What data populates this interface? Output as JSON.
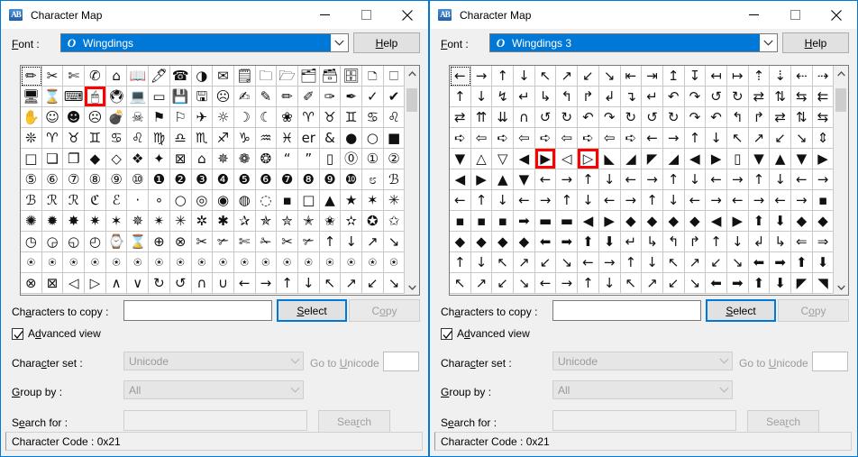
{
  "windows": [
    {
      "title": "Character Map",
      "app_icon": "character-map-icon",
      "controls": {
        "minimize": "Minimize",
        "maximize": "Maximize",
        "close": "Close"
      },
      "font": {
        "label": "Font :",
        "label_prefix": "F",
        "label_rest": "ont :",
        "value": "Wingdings",
        "tt_icon": "truetype-icon",
        "dropdown_icon": "chevron-down-icon"
      },
      "help_label": "Help",
      "grid": {
        "columns": 18,
        "rows": 11,
        "selected_index": 0,
        "highlight_indices": [
          21
        ],
        "scrollbar": {
          "up_icon": "chevron-up-icon",
          "down_icon": "chevron-down-icon",
          "thumb_position": "top"
        },
        "chars": [
          "✏",
          "✂",
          "✄",
          "✆",
          "⌂",
          "📖",
          "🖊",
          "☎",
          "◑",
          "✉",
          "🗒",
          "🗀",
          "🗁",
          "🗂",
          "🗃",
          "🗄",
          "🗅",
          "🗆",
          "🖥",
          "⌛",
          "⌨",
          "🖱",
          "🖲",
          "💻",
          "▭",
          "💾",
          "🖫",
          "☹",
          "✍",
          "✎",
          "✏",
          "✐",
          "✑",
          "✒",
          "✓",
          "✔",
          "✋",
          "☺",
          "☻",
          "☹",
          "💣",
          "☠",
          "⚑",
          "⚐",
          "✈",
          "☼",
          "☽",
          "☾",
          "❀",
          "♈",
          "♉",
          "♊",
          "♋",
          "♌",
          "❊",
          "♈",
          "♉",
          "♊",
          "♋",
          "♌",
          "♍",
          "♎",
          "♏",
          "♐",
          "♑",
          "♒",
          "♓",
          "er",
          "&",
          "●",
          "○",
          "■",
          "□",
          "❏",
          "❐",
          "◆",
          "◇",
          "❖",
          "✦",
          "⊠",
          "⌂",
          "✵",
          "❁",
          "❂",
          "“",
          "”",
          "▯",
          "⓪",
          "①",
          "②",
          "⑤",
          "⑥",
          "⑦",
          "⑧",
          "⑨",
          "⑩",
          "❶",
          "❷",
          "❸",
          "❹",
          "❺",
          "❻",
          "❼",
          "❽",
          "❾",
          "❿",
          "೮",
          "ℬ",
          "ℬ",
          "ℛ",
          "ℛ",
          "ℭ",
          "ℰ",
          "·",
          "∘",
          "○",
          "◎",
          "◉",
          "◍",
          "◌",
          "▪",
          "□",
          "▲",
          "★",
          "✶",
          "✳",
          "✺",
          "✹",
          "✸",
          "✷",
          "✶",
          "✵",
          "✴",
          "✳",
          "✲",
          "✱",
          "✰",
          "✯",
          "✮",
          "✭",
          "✬",
          "✫",
          "✪",
          "✩",
          "◷",
          "◶",
          "◵",
          "◴",
          "⌚",
          "⌛",
          "⊕",
          "⊗",
          "✂",
          "✃",
          "✄",
          "✁",
          "✂",
          "✃",
          "↑",
          "↓",
          "↗",
          "↘",
          "⍟",
          "⍟",
          "⍟",
          "⍟",
          "⍟",
          "⍟",
          "⍟",
          "⍟",
          "⍟",
          "⍟",
          "⍟",
          "⍟",
          "⍟",
          "⍟",
          "⍟",
          "⍟",
          "⍟",
          "⍟",
          "⊗",
          "⊠",
          "◁",
          "▷",
          "∧",
          "∨",
          "↻",
          "↺",
          "∩",
          "∪",
          "←",
          "→",
          "↑",
          "↓",
          "↖",
          "↗",
          "↙",
          "↘"
        ]
      },
      "form": {
        "characters_to_copy_label": "Characters to copy :",
        "characters_to_copy_value": "",
        "select_label": "Select",
        "copy_label": "Copy",
        "advanced_view_label": "Advanced view",
        "advanced_view_checked": true,
        "character_set_label": "Character set :",
        "character_set_value": "Unicode",
        "go_to_unicode_label": "Go to Unicode :",
        "go_to_unicode_value": "",
        "group_by_label": "Group by :",
        "group_by_value": "All",
        "search_for_label": "Search for :",
        "search_for_value": "",
        "search_label": "Search"
      },
      "status": "Character Code : 0x21"
    },
    {
      "title": "Character Map",
      "app_icon": "character-map-icon",
      "controls": {
        "minimize": "Minimize",
        "maximize": "Maximize",
        "close": "Close"
      },
      "font": {
        "label": "Font :",
        "label_prefix": "F",
        "label_rest": "ont :",
        "value": "Wingdings 3",
        "tt_icon": "truetype-icon",
        "dropdown_icon": "chevron-down-icon"
      },
      "help_label": "Help",
      "grid": {
        "columns": 18,
        "rows": 11,
        "selected_index": 0,
        "highlight_indices": [
          76,
          78
        ],
        "scrollbar": {
          "up_icon": "chevron-up-icon",
          "down_icon": "chevron-down-icon",
          "thumb_position": "top"
        },
        "chars": [
          "←",
          "→",
          "↑",
          "↓",
          "↖",
          "↗",
          "↙",
          "↘",
          "⇤",
          "⇥",
          "↥",
          "↧",
          "↤",
          "↦",
          "⇡",
          "⇣",
          "⇠",
          "⇢",
          "↑",
          "↓",
          "↯",
          "↵",
          "↳",
          "↰",
          "↱",
          "↲",
          "↴",
          "↵",
          "↶",
          "↷",
          "↺",
          "↻",
          "⇄",
          "⇅",
          "⇆",
          "⇇",
          "⇄",
          "⇈",
          "⇊",
          "∩",
          "↺",
          "↻",
          "↶",
          "↷",
          "↻",
          "↺",
          "↻",
          "↷",
          "↶",
          "↰",
          "↱",
          "⇄",
          "⇅",
          "⇆",
          "➪",
          "⇦",
          "➪",
          "⇦",
          "➪",
          "⇦",
          "➪",
          "⇦",
          "➪",
          "←",
          "→",
          "↑",
          "↓",
          "↖",
          "↗",
          "↙",
          "↘",
          "⇕",
          "▼",
          "△",
          "▽",
          "◀",
          "▶",
          "◁",
          "▷",
          "◣",
          "◢",
          "◤",
          "◢",
          "◀",
          "▶",
          "▯",
          "▼",
          "▲",
          "▼",
          "▶",
          "◀",
          "▶",
          "▲",
          "▼",
          "←",
          "→",
          "↑",
          "↓",
          "←",
          "→",
          "↑",
          "↓",
          "←",
          "→",
          "↑",
          "↓",
          "←",
          "→",
          "←",
          "↑",
          "↓",
          "←",
          "→",
          "↑",
          "↓",
          "←",
          "→",
          "↑",
          "↓",
          "←",
          "→",
          "←",
          "→",
          "←",
          "→",
          "▪",
          "▪",
          "▪",
          "▪",
          "➡",
          "▬",
          "▬",
          "◀",
          "▶",
          "◆",
          "◆",
          "◆",
          "◆",
          "◀",
          "▶",
          "⬆",
          "⬇",
          "◆",
          "◆",
          "◆",
          "◆",
          "◆",
          "◆",
          "⬅",
          "➡",
          "⬆",
          "⬇",
          "↵",
          "↳",
          "↰",
          "↱",
          "↑",
          "↓",
          "↲",
          "↳",
          "⇐",
          "⇒",
          "↑",
          "↓",
          "↖",
          "↗",
          "↙",
          "↘",
          "←",
          "→",
          "↑",
          "↓",
          "↖",
          "↗",
          "↙",
          "↘",
          "⬅",
          "➡",
          "⬆",
          "⬇",
          "↖",
          "↗",
          "↙",
          "↘",
          "←",
          "→",
          "↑",
          "↓",
          "↖",
          "↗",
          "↙",
          "↘",
          "⬅",
          "➡",
          "⬆",
          "⬇",
          "◤",
          "◥"
        ]
      },
      "form": {
        "characters_to_copy_label": "Characters to copy :",
        "characters_to_copy_value": "",
        "select_label": "Select",
        "copy_label": "Copy",
        "advanced_view_label": "Advanced view",
        "advanced_view_checked": true,
        "character_set_label": "Character set :",
        "character_set_value": "Unicode",
        "go_to_unicode_label": "Go to Unicode :",
        "go_to_unicode_value": "",
        "group_by_label": "Group by :",
        "group_by_value": "All",
        "search_for_label": "Search for :",
        "search_for_value": "",
        "search_label": "Search"
      },
      "status": "Character Code : 0x21"
    }
  ],
  "colors": {
    "accent": "#0078d7",
    "highlight": "#ff0000",
    "window_bg": "#f0f0f0",
    "titlebar_bg": "#ffffff",
    "button_bg": "#e1e1e1"
  }
}
